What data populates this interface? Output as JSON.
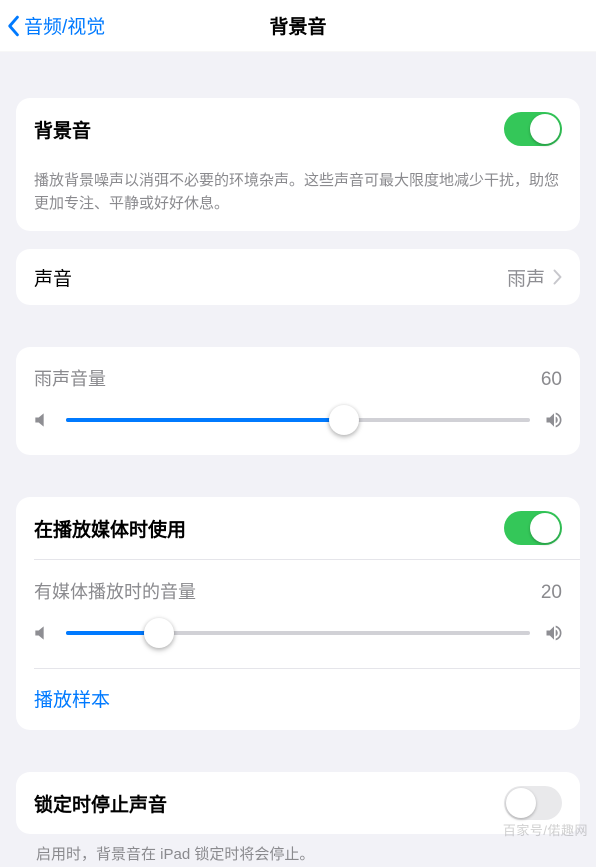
{
  "nav": {
    "back_label": "音频/视觉",
    "title": "背景音"
  },
  "section1": {
    "master_label": "背景音",
    "master_on": true,
    "description": "播放背景噪声以消弭不必要的环境杂声。这些声音可最大限度地减少干扰，助您更加专注、平静或好好休息。"
  },
  "sound": {
    "label": "声音",
    "value": "雨声"
  },
  "volume1": {
    "label": "雨声音量",
    "value": "60",
    "percent": 60
  },
  "media": {
    "use_label": "在播放媒体时使用",
    "use_on": true,
    "volume_label": "有媒体播放时的音量",
    "volume_value": "20",
    "volume_percent": 20,
    "sample_label": "播放样本"
  },
  "lock": {
    "label": "锁定时停止声音",
    "on": false,
    "description": "启用时，背景音在 iPad 锁定时将会停止。"
  },
  "watermark": "百家号/偌趣网"
}
